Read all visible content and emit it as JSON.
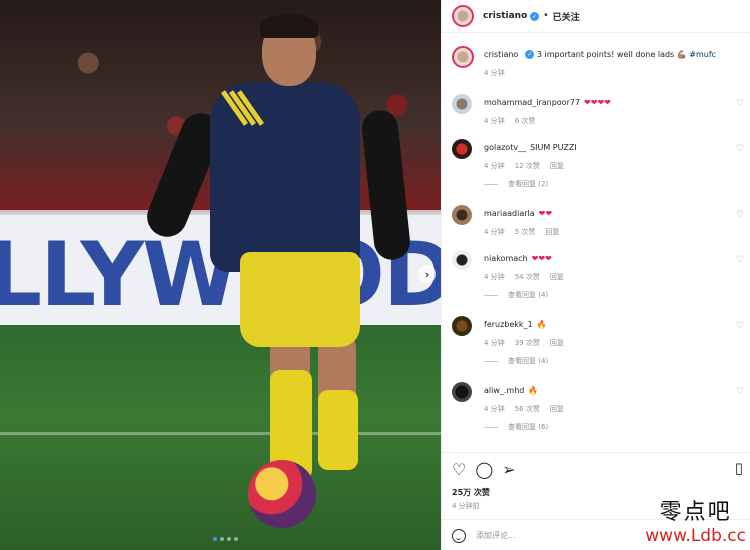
{
  "post": {
    "username": "cristiano",
    "follow_state": "已关注",
    "caption": "3 important points! well done lads 💪🏽",
    "caption_tag": "#mufc",
    "caption_time": "4 分钟",
    "likes": "25万 次赞",
    "posted": "4 分钟前",
    "photo_dots": 4
  },
  "comments": [
    {
      "user": "mohammad_iranpoor77",
      "text": "❤❤❤❤",
      "red": true,
      "time": "4 分钟",
      "likes": "6 次赞",
      "reply": "",
      "view_replies": ""
    },
    {
      "user": "golazotv__",
      "text": "SIUM PUZZI",
      "red": false,
      "time": "4 分钟",
      "likes": "12 次赞",
      "reply": "回复",
      "view_replies": "查看回复 (2)"
    },
    {
      "user": "mariaadiarla",
      "text": "❤❤",
      "red": true,
      "time": "4 分钟",
      "likes": "5 次赞",
      "reply": "回复",
      "view_replies": ""
    },
    {
      "user": "niakomach",
      "text": "❤❤❤",
      "red": true,
      "time": "4 分钟",
      "likes": "54 次赞",
      "reply": "回复",
      "view_replies": "查看回复 (4)"
    },
    {
      "user": "feruzbekk_1",
      "text": "🔥",
      "red": false,
      "time": "4 分钟",
      "likes": "39 次赞",
      "reply": "回复",
      "view_replies": "查看回复 (4)"
    },
    {
      "user": "aliw_.mhd",
      "text": "🔥",
      "red": false,
      "time": "4 分钟",
      "likes": "56 次赞",
      "reply": "回复",
      "view_replies": "查看回复 (6)"
    }
  ],
  "comment_input": {
    "placeholder": "添加评论..."
  },
  "watermark": {
    "cn": "零点吧",
    "en": "www.Ldb.cc"
  },
  "icons": {
    "like": "heart-icon",
    "comment": "comment-icon",
    "share": "share-icon",
    "save": "bookmark-icon",
    "next": "chevron-right-icon",
    "emoji": "emoji-icon"
  }
}
